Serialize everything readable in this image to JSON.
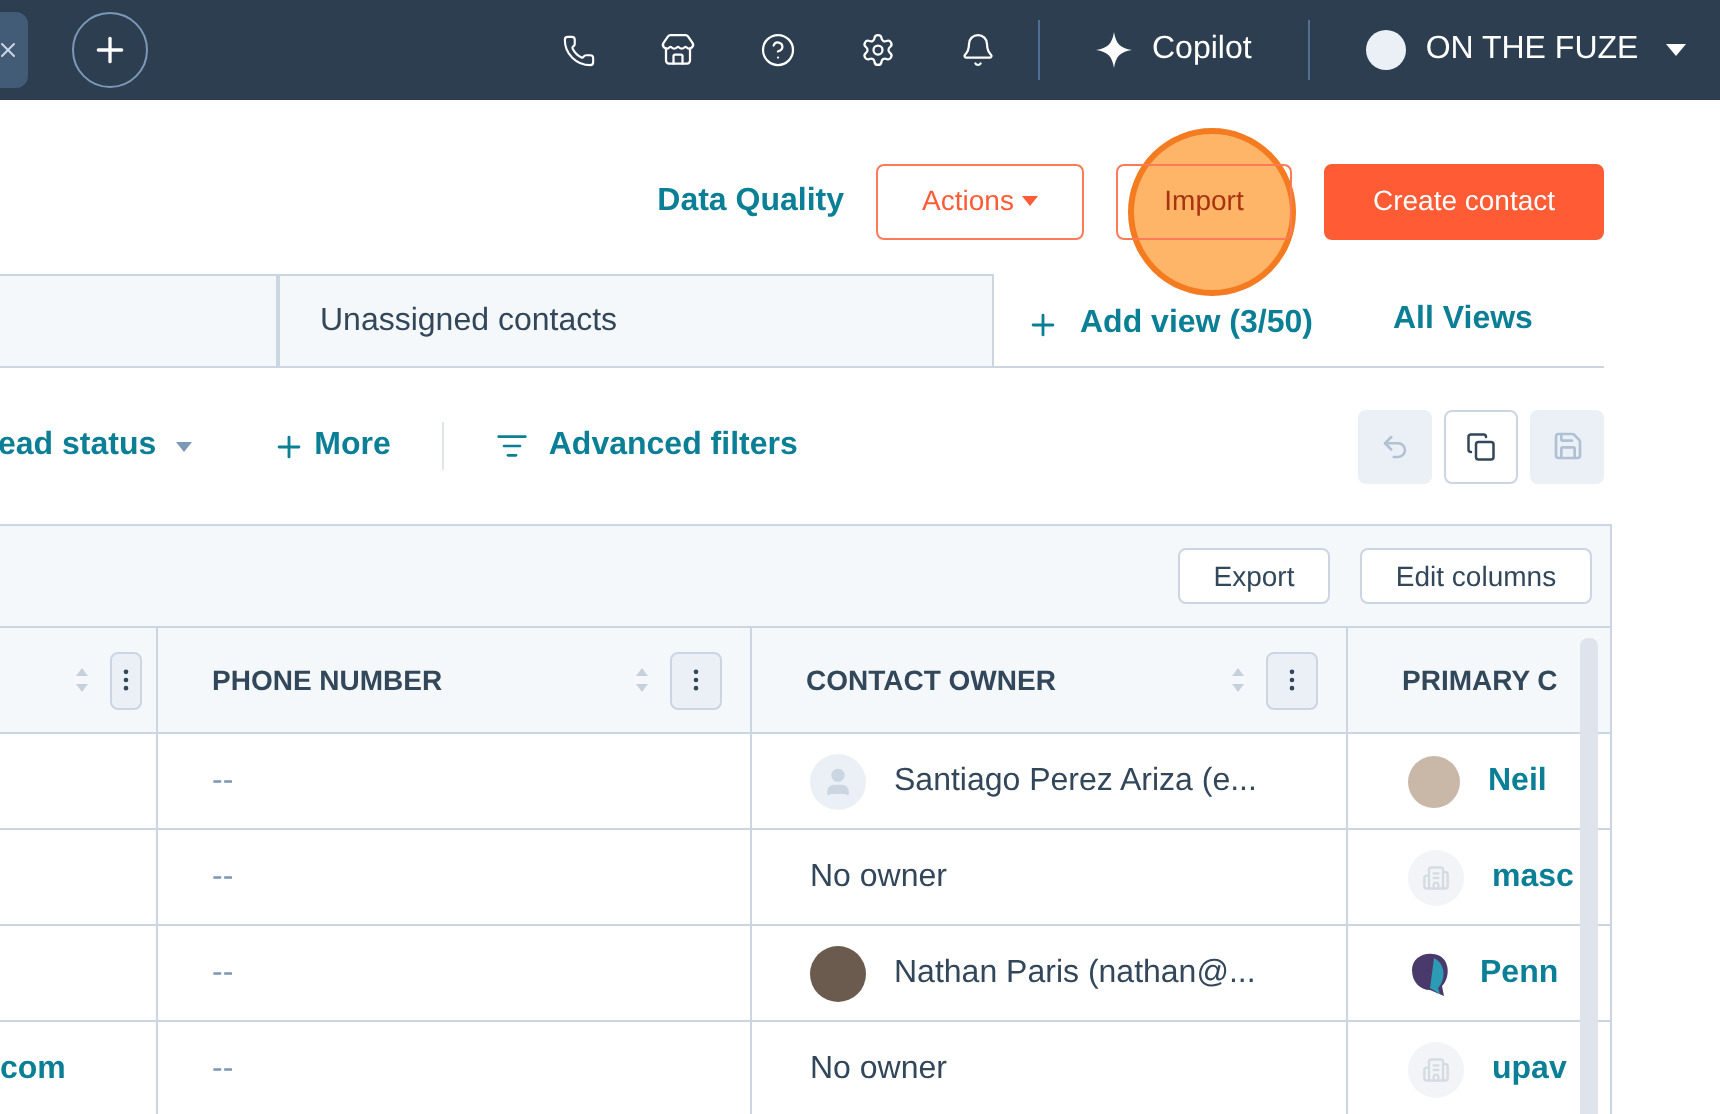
{
  "top_bar": {
    "copilot": "Copilot",
    "account": "ON THE FUZE"
  },
  "actions": {
    "data_quality": "Data Quality",
    "actions": "Actions",
    "import": "Import",
    "create": "Create contact"
  },
  "views": {
    "tab": "Unassigned contacts",
    "add_view": "Add view (3/50)",
    "all_views": "All Views"
  },
  "filters": {
    "lead_status": "ead status",
    "more": "More",
    "advanced": "Advanced filters"
  },
  "table": {
    "export": "Export",
    "edit_columns": "Edit columns",
    "columns": [
      {},
      {
        "label": "PHONE NUMBER"
      },
      {
        "label": "CONTACT OWNER"
      },
      {
        "label": "PRIMARY C"
      }
    ],
    "rows": [
      {
        "phone": "--",
        "owner": {
          "kind": "silhouette",
          "name": "Santiago Perez Ariza (e..."
        },
        "company": {
          "kind": "photo",
          "name": "Neil"
        }
      },
      {
        "phone": "--",
        "owner": {
          "kind": "none",
          "name": "No owner"
        },
        "company": {
          "kind": "building",
          "name": "masc"
        }
      },
      {
        "phone": "--",
        "owner": {
          "kind": "photo",
          "name": "Nathan Paris (nathan@..."
        },
        "company": {
          "kind": "logo",
          "name": "Penn"
        }
      },
      {
        "column_1": "com",
        "phone": "--",
        "owner": {
          "kind": "none",
          "name": "No owner"
        },
        "company": {
          "kind": "building",
          "name": "upav"
        }
      }
    ]
  }
}
